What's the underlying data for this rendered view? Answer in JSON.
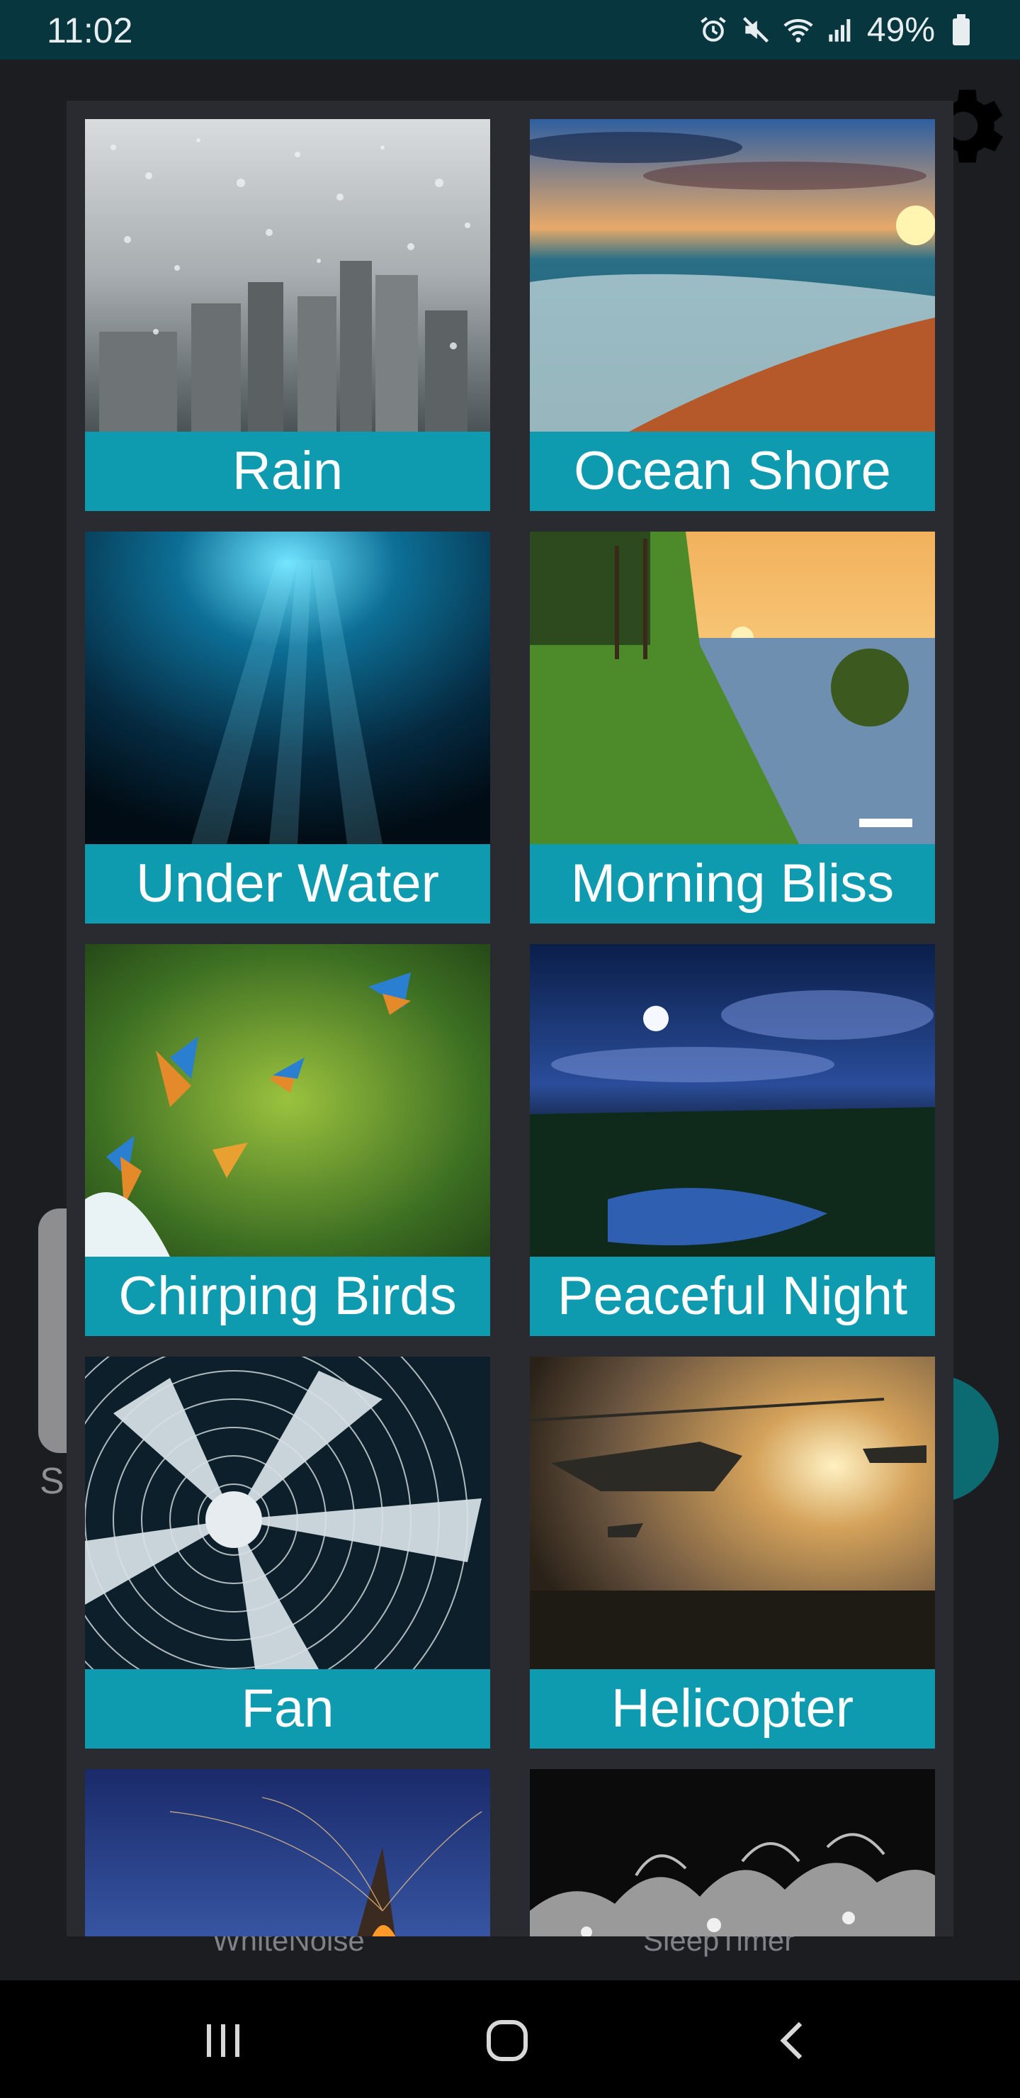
{
  "status_bar": {
    "time": "11:02",
    "battery": "49%",
    "icons": [
      "alarm-icon",
      "mute-icon",
      "wifi-icon",
      "signal-icon",
      "battery-icon"
    ]
  },
  "background_app": {
    "settings_icon": "gear-icon",
    "partial_label": "S",
    "tabs": [
      "WhiteNoise",
      "SleepTimer"
    ]
  },
  "sounds": [
    {
      "label": "Rain",
      "image": "rain-on-window"
    },
    {
      "label": "Ocean Shore",
      "image": "beach-sunset"
    },
    {
      "label": "Under Water",
      "image": "underwater-light"
    },
    {
      "label": "Morning Bliss",
      "image": "lake-sunrise"
    },
    {
      "label": "Chirping Birds",
      "image": "kingfishers"
    },
    {
      "label": "Peaceful Night",
      "image": "moonlit-lake"
    },
    {
      "label": "Fan",
      "image": "fan-blades"
    },
    {
      "label": "Helicopter",
      "image": "helicopters-sunset"
    },
    {
      "label": "",
      "image": "bonfire-beach"
    },
    {
      "label": "",
      "image": "water-splash"
    }
  ],
  "navigation": {
    "recents": "recents-icon",
    "home": "home-icon",
    "back": "back-icon"
  },
  "colors": {
    "status_bar": "#07363f",
    "label_bg": "#0e9bb0",
    "dialog_bg": "#2a2b31"
  }
}
